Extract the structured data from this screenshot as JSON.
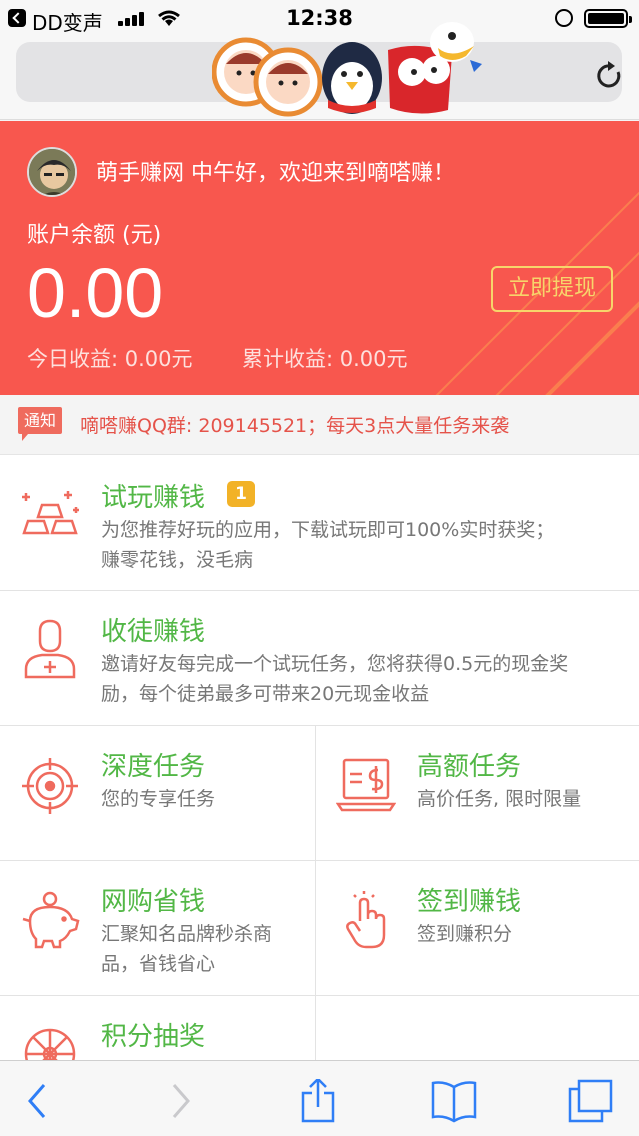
{
  "status_bar": {
    "carrier": "DD变声",
    "time": "12:38"
  },
  "hero": {
    "greeting": "萌手赚网 中午好，欢迎来到嘀嗒赚！",
    "balance_label": "账户余额 (元)",
    "balance_value": "0.00",
    "withdraw_label": "立即提现",
    "today_income": "今日收益: 0.00元",
    "total_income": "累计收益: 0.00元",
    "colors": {
      "background": "#f8574e",
      "accent": "#f7d56b"
    }
  },
  "notice": {
    "tag": "通知",
    "text": "嘀嗒赚QQ群: 209145521；每天3点大量任务来袭"
  },
  "tasks": {
    "trial": {
      "title": "试玩赚钱",
      "badge": "1",
      "desc_line1": "为您推荐好玩的应用，下载试玩即可100%实时获奖；",
      "desc_line2": "赚零花钱，没毛病",
      "icon": "gold-bars-icon"
    },
    "invite": {
      "title": "收徒赚钱",
      "desc_line1": "邀请好友每完成一个试玩任务，您将获得0.5元的现金奖",
      "desc_line2": "励，每个徒弟最多可带来20元现金收益",
      "icon": "add-user-icon"
    },
    "deep": {
      "title": "深度任务",
      "desc": "您的专享任务",
      "icon": "target-icon"
    },
    "high": {
      "title": "高额任务",
      "desc": "高价任务, 限时限量",
      "icon": "laptop-dollar-icon"
    },
    "shopping": {
      "title": "网购省钱",
      "desc_line1": "汇聚知名品牌秒杀商",
      "desc_line2": "品，省钱省心",
      "icon": "piggy-bank-icon"
    },
    "checkin": {
      "title": "签到赚钱",
      "desc": "签到赚积分",
      "icon": "tap-hand-icon"
    },
    "lottery": {
      "title": "积分抽奖",
      "icon": "wheel-icon"
    },
    "colors": {
      "title": "#52b746",
      "icon": "#ef6b5e"
    }
  },
  "toolbar": {
    "icons": [
      "back-icon",
      "forward-icon",
      "share-icon",
      "bookmarks-icon",
      "tabs-icon"
    ],
    "color": "#2f7ef6"
  }
}
